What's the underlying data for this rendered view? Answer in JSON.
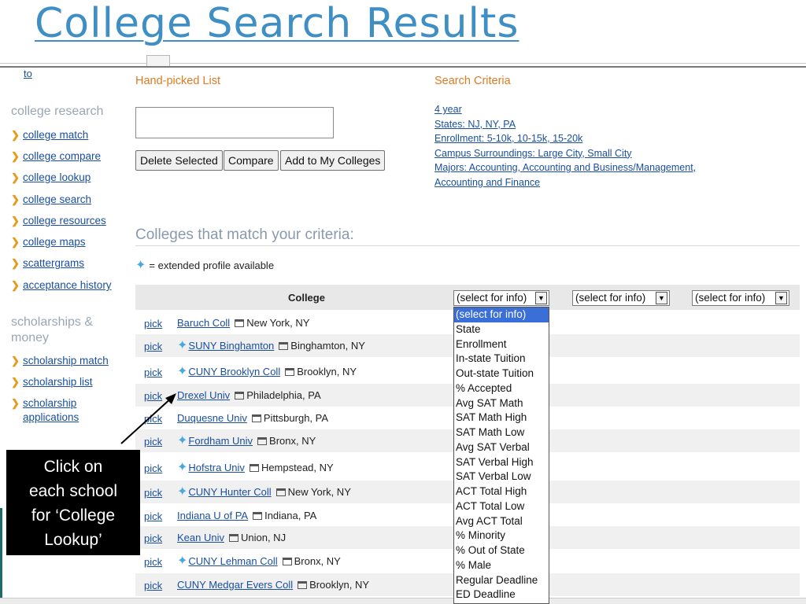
{
  "slide_title": "College Search Results",
  "sidebar": {
    "top_link": "to",
    "section1_heading": "college research",
    "section1_items": [
      "college match",
      "college compare",
      "college lookup",
      "college search",
      "college resources",
      "college maps",
      "scattergrams",
      "acceptance history"
    ],
    "section2_heading": "scholarships & money",
    "section2_items": [
      "scholarship match",
      "scholarship list",
      "scholarship applications"
    ]
  },
  "handpicked": {
    "label": "Hand-picked List",
    "buttons": [
      "Delete Selected",
      "Compare",
      "Add to My Colleges"
    ]
  },
  "criteria": {
    "label": "Search Criteria",
    "items": [
      "4 year",
      "States: NJ, NY, PA",
      "Enrollment: 5-10k, 10-15k, 15-20k",
      "Campus Surroundings: Large City, Small City",
      "Majors: Accounting, Accounting and Business/Management,",
      "Accounting and Finance"
    ]
  },
  "results": {
    "title": "Colleges that match your criteria:",
    "legend": "= extended profile available",
    "column_college": "College",
    "select_value": "(select for info)",
    "rows": [
      {
        "pick": "pick",
        "name": "Baruch Coll",
        "loc": "New York, NY",
        "star": false
      },
      {
        "pick": "pick",
        "name": "SUNY Binghamton",
        "loc": "Binghamton, NY",
        "star": true
      },
      {
        "pick": "pick",
        "name": "CUNY Brooklyn Coll",
        "loc": "Brooklyn, NY",
        "star": true
      },
      {
        "pick": "pick",
        "name": "Drexel Univ",
        "loc": "Philadelphia, PA",
        "star": false
      },
      {
        "pick": "pick",
        "name": "Duquesne Univ",
        "loc": "Pittsburgh, PA",
        "star": false
      },
      {
        "pick": "pick",
        "name": "Fordham Univ",
        "loc": "Bronx, NY",
        "star": true
      },
      {
        "pick": "pick",
        "name": "Hofstra Univ",
        "loc": "Hempstead, NY",
        "star": true
      },
      {
        "pick": "pick",
        "name": "CUNY Hunter Coll",
        "loc": "New York, NY",
        "star": true
      },
      {
        "pick": "pick",
        "name": "Indiana U of PA",
        "loc": "Indiana, PA",
        "star": false
      },
      {
        "pick": "pick",
        "name": "Kean Univ",
        "loc": "Union, NJ",
        "star": false
      },
      {
        "pick": "pick",
        "name": "CUNY Lehman Coll",
        "loc": "Bronx, NY",
        "star": true
      },
      {
        "pick": "pick",
        "name": "CUNY Medgar Evers Coll",
        "loc": "Brooklyn, NY",
        "star": false
      }
    ]
  },
  "dropdown_options": [
    "(select for info)",
    "State",
    "Enrollment",
    "In-state Tuition",
    "Out-state Tuition",
    "% Accepted",
    "Avg SAT Math",
    "SAT Math High",
    "SAT Math Low",
    "Avg SAT Verbal",
    "SAT Verbal High",
    "SAT Verbal Low",
    "ACT Total High",
    "ACT Total Low",
    "Avg ACT Total",
    "% Minority",
    "% Out of State",
    "% Male",
    "Regular Deadline",
    "ED Deadline"
  ],
  "callout": {
    "lines": [
      "Click on",
      "each school",
      "for ‘College",
      "Lookup’"
    ]
  },
  "colors": {
    "title": "#3f8fc4",
    "link": "#1a4fa0",
    "accent_orange": "#e07a20",
    "dropdown_highlight": "#3a6fd8",
    "star": "#4aa8e0"
  },
  "icons": {
    "sidebar_bullet": "chevron-right-icon",
    "extended_profile": "star-sparkle-icon",
    "location": "window-icon",
    "select_arrow": "triangle-down-icon"
  }
}
